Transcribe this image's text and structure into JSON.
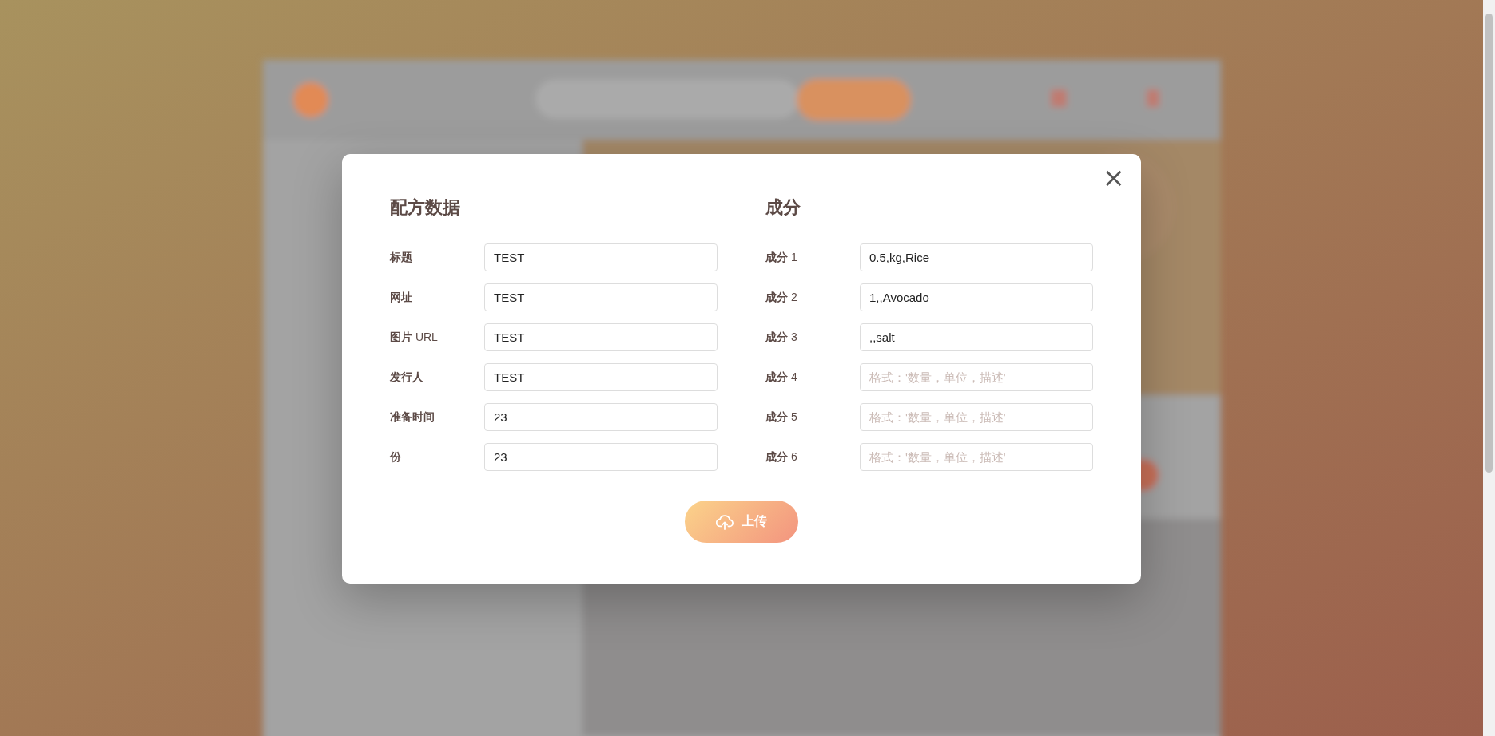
{
  "dialog": {
    "close_label": "×",
    "recipe": {
      "title": "配方数据",
      "fields": [
        {
          "label": "标题",
          "value": "TEST"
        },
        {
          "label": "网址",
          "value": "TEST"
        },
        {
          "label": "**图片** URL",
          "value": "TEST"
        },
        {
          "label": "发行人",
          "value": "TEST"
        },
        {
          "label": "准备时间",
          "value": "23"
        },
        {
          "label": "份",
          "value": "23"
        }
      ]
    },
    "ingredients": {
      "title": "成分",
      "fields": [
        {
          "label": "**成分** 1",
          "value": "0.5,kg,Rice"
        },
        {
          "label": "**成分** 2",
          "value": "1,,Avocado"
        },
        {
          "label": "**成分** 3",
          "value": ",,salt"
        },
        {
          "label": "**成分** 4",
          "placeholder": "格式：'数量，单位，描述'"
        },
        {
          "label": "**成分** 5",
          "placeholder": "格式：'数量，单位，描述'"
        },
        {
          "label": "**成分** 6",
          "placeholder": "格式：'数量，单位，描述'"
        }
      ]
    },
    "upload_button": "上传"
  }
}
